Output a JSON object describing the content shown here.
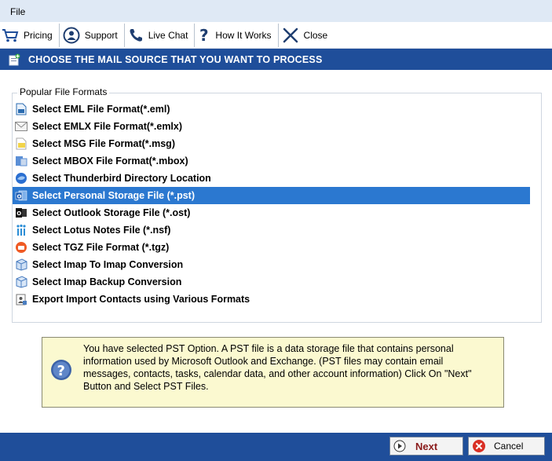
{
  "menu": {
    "file": "File"
  },
  "toolbar": {
    "pricing": "Pricing",
    "support": "Support",
    "live_chat": "Live Chat",
    "how_it_works": "How It Works",
    "close": "Close"
  },
  "header": {
    "title": "CHOOSE THE MAIL SOURCE THAT YOU WANT TO PROCESS"
  },
  "formats": {
    "legend": "Popular File Formats",
    "items": [
      {
        "label": "Select EML File Format(*.eml)",
        "icon": "eml-file-icon"
      },
      {
        "label": "Select EMLX File Format(*.emlx)",
        "icon": "emlx-envelope-icon"
      },
      {
        "label": "Select MSG File Format(*.msg)",
        "icon": "msg-file-icon"
      },
      {
        "label": "Select MBOX File Format(*.mbox)",
        "icon": "mbox-icon"
      },
      {
        "label": "Select Thunderbird Directory Location",
        "icon": "thunderbird-icon"
      },
      {
        "label": "Select Personal Storage File (*.pst)",
        "icon": "outlook-pst-icon",
        "selected": true
      },
      {
        "label": "Select Outlook Storage File (*.ost)",
        "icon": "outlook-ost-icon"
      },
      {
        "label": "Select Lotus Notes File (*.nsf)",
        "icon": "lotus-notes-icon"
      },
      {
        "label": "Select TGZ File Format (*.tgz)",
        "icon": "tgz-icon"
      },
      {
        "label": "Select Imap To Imap Conversion",
        "icon": "imap-icon"
      },
      {
        "label": "Select Imap Backup Conversion",
        "icon": "imap-backup-icon"
      },
      {
        "label": "Export Import Contacts using Various Formats",
        "icon": "contacts-icon"
      }
    ]
  },
  "info": {
    "text": "You have selected PST Option. A PST file is a data storage file that contains personal information used by Microsoft Outlook and Exchange. (PST files may contain email messages, contacts, tasks, calendar data, and other account information) Click On \"Next\" Button and Select PST Files."
  },
  "footer": {
    "next": "Next",
    "cancel": "Cancel"
  },
  "colors": {
    "accent": "#1f4e9a",
    "selection": "#2b78d0",
    "info_bg": "#fbf9d0",
    "next_text": "#8a1b1b"
  }
}
